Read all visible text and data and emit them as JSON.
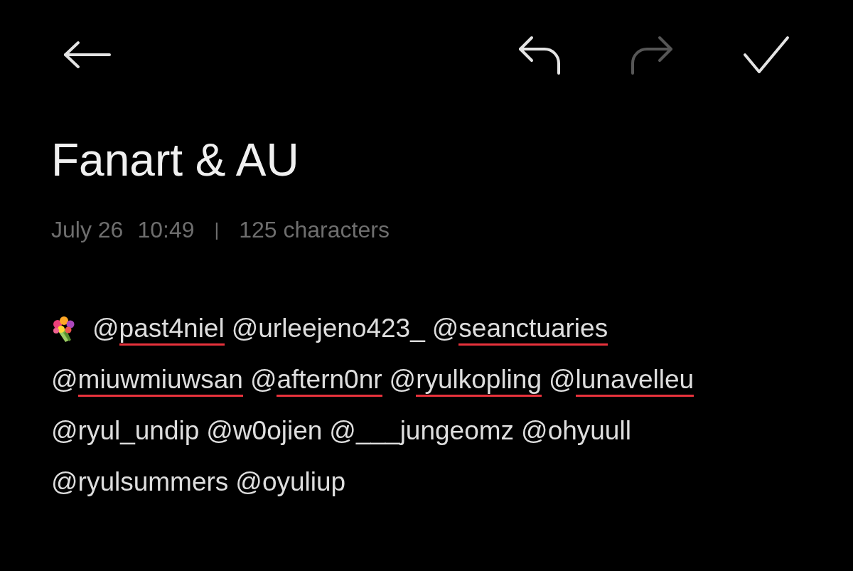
{
  "toolbar": {
    "actions": [
      {
        "kind": "undo",
        "disabled": false
      },
      {
        "kind": "redo",
        "disabled": true
      },
      {
        "kind": "done",
        "disabled": false
      }
    ]
  },
  "note": {
    "title": "Fanart & AU",
    "meta": {
      "date": "July 26",
      "time": "10:49",
      "separator": "|",
      "char_count": "125 characters"
    },
    "lines": [
      {
        "tokens": [
          {
            "kind": "emoji"
          },
          {
            "kind": "mention",
            "prefix": "@",
            "handle": "past4niel",
            "misspelled": true
          },
          {
            "kind": "mention",
            "prefix": "@",
            "handle": "urleejeno423_",
            "misspelled": false
          },
          {
            "kind": "mention",
            "prefix": "@",
            "handle": "seanctuaries",
            "misspelled": true
          }
        ]
      },
      {
        "tokens": [
          {
            "kind": "mention",
            "prefix": "@",
            "handle": "miuwmiuwsan",
            "misspelled": true
          },
          {
            "kind": "mention",
            "prefix": "@",
            "handle": "aftern0nr",
            "misspelled": true
          },
          {
            "kind": "mention",
            "prefix": "@",
            "handle": "ryulkopling",
            "misspelled": true
          },
          {
            "kind": "mention",
            "prefix": "@",
            "handle": "lunavelleu",
            "misspelled": true
          }
        ]
      },
      {
        "tokens": [
          {
            "kind": "mention",
            "prefix": "@",
            "handle": "ryul_undip",
            "misspelled": false
          },
          {
            "kind": "mention",
            "prefix": "@",
            "handle": "w0ojien",
            "misspelled": false
          },
          {
            "kind": "mention",
            "prefix": "@",
            "handle": "___jungeomz",
            "misspelled": false
          },
          {
            "kind": "mention",
            "prefix": "@",
            "handle": "ohyuull",
            "misspelled": false
          }
        ]
      },
      {
        "tokens": [
          {
            "kind": "mention",
            "prefix": "@",
            "handle": "ryulsummers",
            "misspelled": false
          },
          {
            "kind": "mention",
            "prefix": "@",
            "handle": "oyuliup",
            "misspelled": false
          }
        ]
      }
    ]
  }
}
